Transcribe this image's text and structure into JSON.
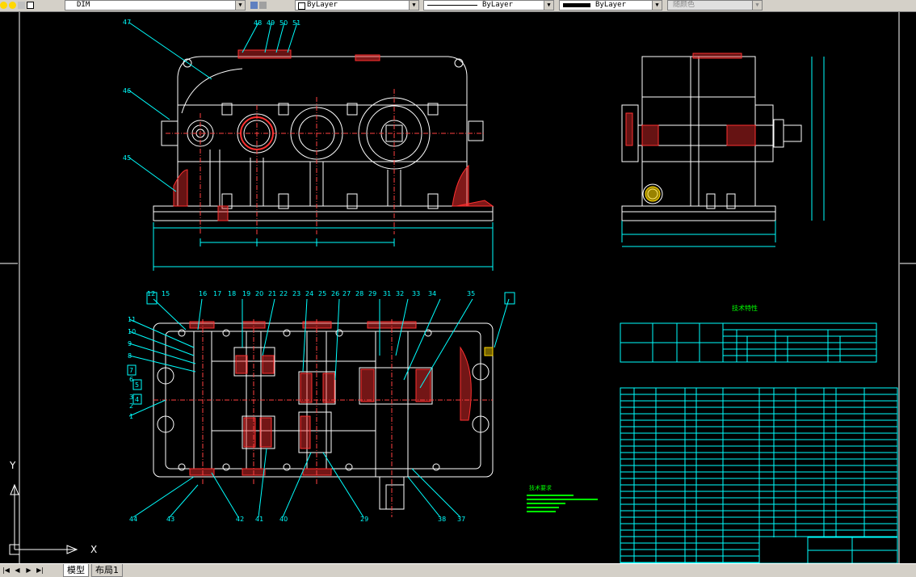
{
  "toolbar": {
    "layer_name": "DIM",
    "linetype_value": "ByLayer",
    "lineweight_value": "ByLayer",
    "color_value": "ByLayer",
    "plotstyle_value": "随颜色"
  },
  "drawing": {
    "front_view_labels": [
      "47",
      "46",
      "45",
      "48",
      "49",
      "50",
      "51"
    ],
    "plan_view_top_labels": [
      "12",
      "15",
      "16",
      "17",
      "18",
      "19",
      "20",
      "21",
      "22",
      "23",
      "24",
      "25",
      "26",
      "27",
      "28",
      "29",
      "31",
      "32",
      "33",
      "34",
      "35"
    ],
    "plan_view_left_labels": [
      "11",
      "10",
      "9",
      "8",
      "7",
      "6",
      "5",
      "4",
      "3",
      "2",
      "1"
    ],
    "plan_view_bottom_labels": [
      "44",
      "43",
      "42",
      "41",
      "40",
      "29",
      "38",
      "37"
    ],
    "table_title": "技术特性",
    "notes_title": "技术要求"
  },
  "ucs": {
    "x_label": "X",
    "y_label": "Y"
  },
  "status": {
    "nav_first": "|◀",
    "nav_prev": "◀",
    "nav_next": "▶",
    "nav_last": "▶|",
    "tab_model": "模型",
    "tab_layout1": "布局1"
  },
  "colors": {
    "canvas_bg": "#000000",
    "outline": "#ffffff",
    "dimension": "#00ffff",
    "centerline": "#ff4040",
    "hatch": "#ff3030",
    "notes": "#00ff00"
  }
}
